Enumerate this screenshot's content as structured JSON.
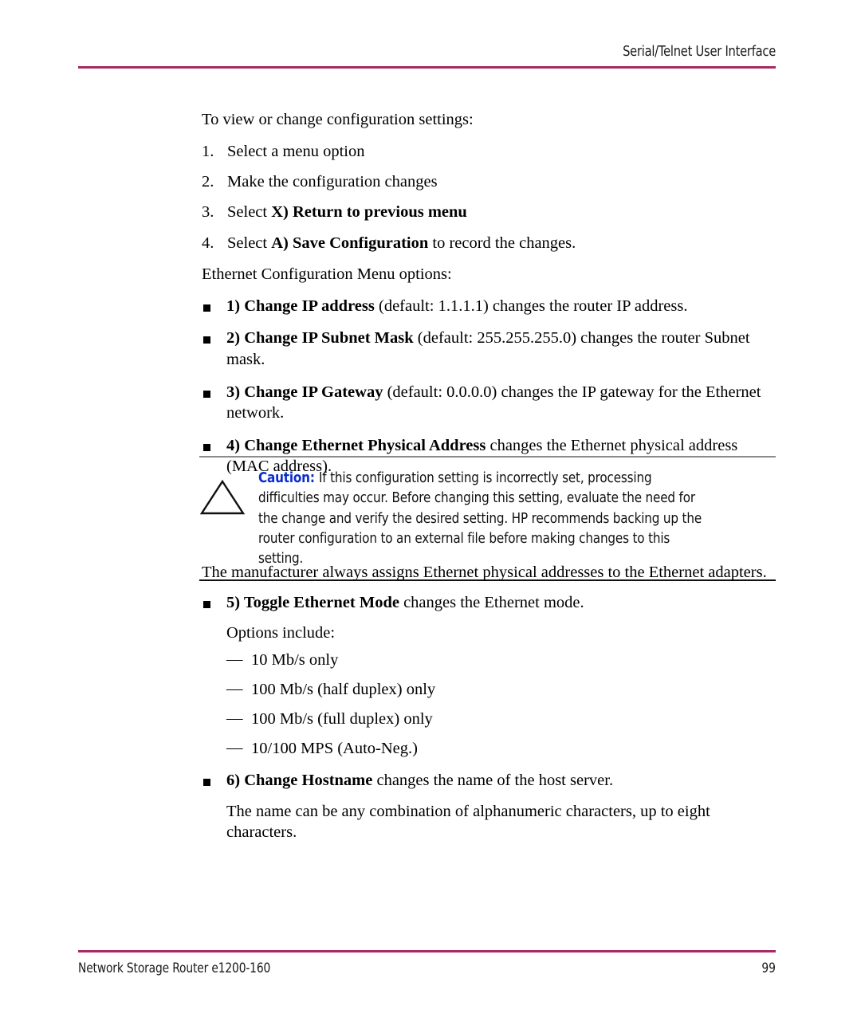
{
  "header": {
    "title": "Serial/Telnet User Interface",
    "rule_color": "#a82a63"
  },
  "body": {
    "intro": "To view or change configuration settings:",
    "procedure": [
      {
        "num": "1.",
        "pre": "Select a menu option",
        "bold": "",
        "post": ""
      },
      {
        "num": "2.",
        "pre": "Make the configuration changes",
        "bold": "",
        "post": ""
      },
      {
        "num": "3.",
        "pre": "Select ",
        "bold": "X) Return to previous menu",
        "post": ""
      },
      {
        "num": "4.",
        "pre": "Select ",
        "bold": "A) Save Configuration",
        "post": " to record the changes."
      }
    ],
    "menu_options_lead": "Ethernet Configuration Menu options:",
    "options_top": [
      {
        "bold": "1) Change IP address",
        "rest": " (default: 1.1.1.1) changes the router IP address."
      },
      {
        "bold": "2) Change IP Subnet Mask",
        "rest": " (default: 255.255.255.0) changes the router Subnet mask."
      },
      {
        "bold": "3) Change IP Gateway",
        "rest": " (default: 0.0.0.0) changes the IP gateway for the Ethernet network."
      },
      {
        "bold": "4) Change Ethernet Physical Address",
        "rest": " changes the Ethernet physical address (MAC address)."
      }
    ],
    "after_caution_para": "The manufacturer always assigns Ethernet physical addresses to the Ethernet adapters.",
    "option_toggle": {
      "bold": "5) Toggle Ethernet Mode",
      "rest": " changes the Ethernet mode.",
      "options_lead": "Options include:",
      "modes": [
        "10 Mb/s only",
        "100 Mb/s (half duplex) only",
        "100 Mb/s (full duplex) only",
        "10/100 MPS (Auto-Neg.)"
      ],
      "dash_mark": "—"
    },
    "option_hostname": {
      "bold": "6) Change Hostname",
      "rest": " changes the name of the host server.",
      "note": "The name can be any combination of alphanumeric characters, up to eight characters."
    }
  },
  "caution": {
    "label": "Caution:",
    "label_color": "#0a2ecc",
    "icon": "warning-triangle-icon",
    "text": "If this configuration setting is incorrectly set, processing difficulties may occur. Before changing this setting, evaluate the need for the change and verify the desired setting. HP recommends backing up the router configuration to an external file before making changes to this setting.",
    "rule_top_color": "#8c8c8c",
    "rule_bottom_color": "#111111"
  },
  "footer": {
    "document_title": "Network Storage Router e1200-160",
    "page_number": "99",
    "rule_color": "#a82a63"
  }
}
